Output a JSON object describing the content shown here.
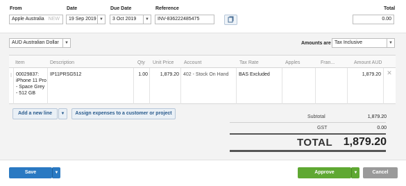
{
  "header": {
    "from_label": "From",
    "from_value": "Apple Australia",
    "from_new_tag": "NEW",
    "date_label": "Date",
    "date_value": "19 Sep 2019",
    "due_label": "Due Date",
    "due_value": "3 Oct 2019",
    "reference_label": "Reference",
    "reference_value": "INV-836222485475",
    "total_label": "Total",
    "total_value": "0.00"
  },
  "options": {
    "currency_value": "AUD Australian Dollar",
    "amounts_are_label": "Amounts are",
    "amounts_are_value": "Tax Inclusive"
  },
  "table": {
    "columns": [
      "Item",
      "Description",
      "Qty",
      "Unit Price",
      "Account",
      "Tax Rate",
      "Apples",
      "Fran...",
      "Amount AUD"
    ],
    "rows": [
      {
        "item": "00029837: iPhone 11 Pro - Space Grey - 512 GB",
        "description": "IP11PRSG512",
        "qty": "1.00",
        "unit_price": "1,879.20",
        "account": "402 - Stock On Hand",
        "tax_rate": "BAS Excluded",
        "apples": "",
        "fran": "",
        "amount": "1,879.20"
      }
    ]
  },
  "actions": {
    "add_line_label": "Add a new line",
    "assign_label": "Assign expenses to a customer or project"
  },
  "summary": {
    "subtotal_label": "Subtotal",
    "subtotal_value": "1,879.20",
    "gst_label": "GST",
    "gst_value": "0.00",
    "total_label": "TOTAL",
    "total_value": "1,879.20"
  },
  "footer": {
    "save_label": "Save",
    "approve_label": "Approve",
    "cancel_label": "Cancel"
  },
  "icons": {
    "calendar_dropdown": "chevron-down-icon",
    "copy_reference": "copy-icon",
    "delete_row": "close-icon",
    "drag_handle": "drag-handle-icon"
  },
  "colors": {
    "save": "#2a79c2",
    "approve": "#5fa832",
    "cancel": "#9a9a9a",
    "link": "#285a8c"
  }
}
